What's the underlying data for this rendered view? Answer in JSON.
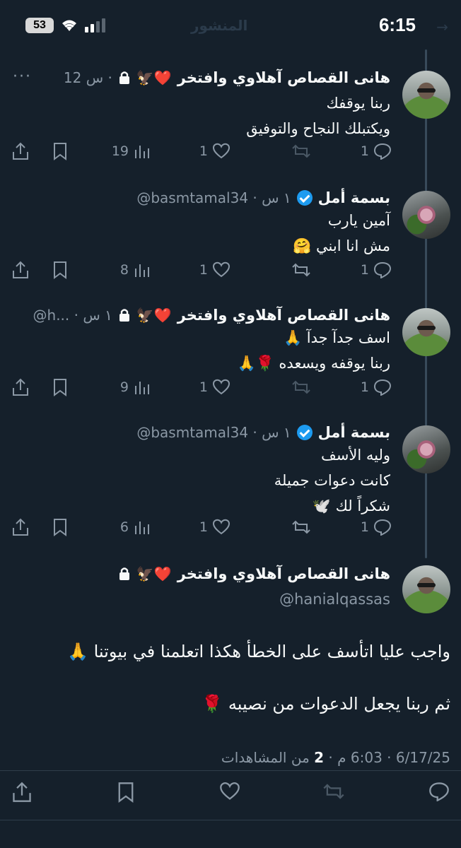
{
  "status_bar": {
    "time": "6:15",
    "battery": "53",
    "ghost_title": "المنشور"
  },
  "tweets": [
    {
      "name": "هانى القصاص آهلاوي وافتخر",
      "badges": "🦅❤️",
      "meta": "12 س ·",
      "lines": [
        "ربنا يوقفك",
        "ويكتبلك النجاح والتوفيق"
      ],
      "replies": "1",
      "reposts": "",
      "likes": "1",
      "views": "19"
    },
    {
      "name": "بسمة أمل",
      "meta": "@basmtamal34 · ١ س",
      "lines": [
        "آمين يارب",
        "مش انا ابني 🤗"
      ],
      "replies": "1",
      "reposts": "",
      "likes": "1",
      "views": "8"
    },
    {
      "name": "هانى القصاص آهلاوي وافتخر",
      "badges": "🦅❤️",
      "meta": "@h... · ١ س",
      "lines": [
        "اسف جدآ جدآ 🙏",
        "ربنا يوقفه ويسعده 🌹🙏"
      ],
      "replies": "1",
      "reposts": "",
      "likes": "1",
      "views": "9"
    },
    {
      "name": "بسمة أمل",
      "meta": "@basmtamal34 · ١ س",
      "lines": [
        "وليه الأسف",
        "كانت دعوات جميلة",
        "شكراً لك 🕊️"
      ],
      "replies": "1",
      "reposts": "",
      "likes": "1",
      "views": "6"
    }
  ],
  "main_tweet": {
    "name": "هانى القصاص آهلاوي وافتخر",
    "badges": "🦅❤️",
    "handle": "@hanialqassas",
    "paragraph_1": "واجب عليا اتأسف على الخطأ هكذا اتعلمنا في بيوتنا 🙏",
    "paragraph_2": "ثم ربنا يجعل الدعوات من نصيبه 🌹",
    "date": "6/17/25",
    "time": "6:03 م",
    "views_count": "2",
    "views_label": "من المشاهدات"
  },
  "icons": {
    "reply": "reply-icon",
    "repost": "repost-icon",
    "like": "heart-icon",
    "views": "views-icon",
    "bookmark": "bookmark-icon",
    "share": "share-icon"
  },
  "colors": {
    "background": "#15202b",
    "muted": "#8b98a5",
    "verified": "#1d9bf0",
    "heart": "#e0245e"
  }
}
